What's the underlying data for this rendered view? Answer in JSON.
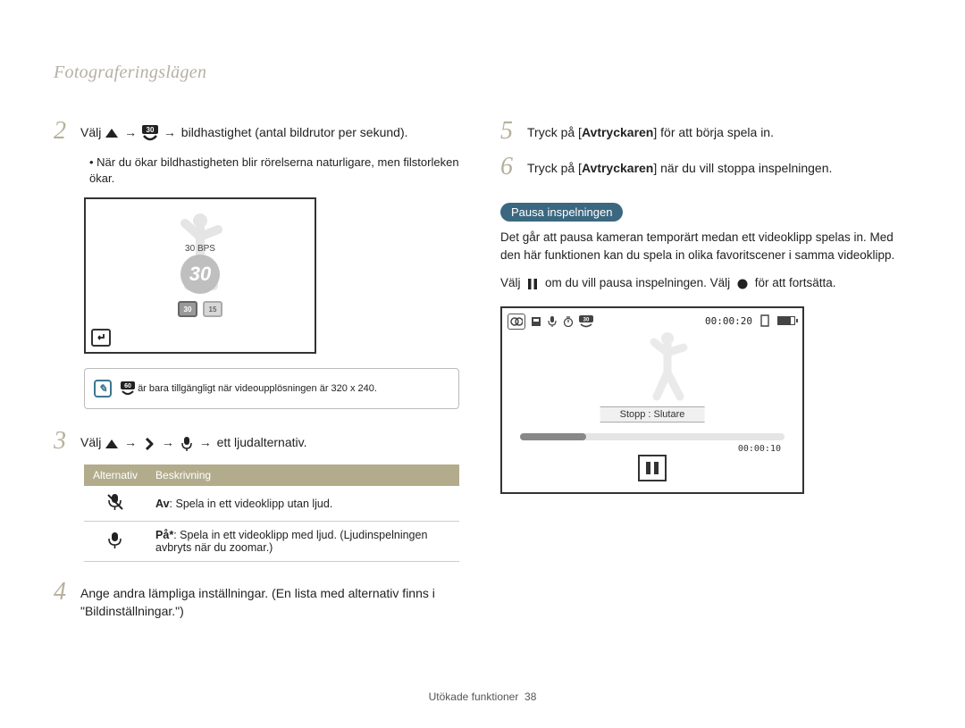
{
  "section_title": "Fotograferingslägen",
  "left": {
    "step2": {
      "num": "2",
      "prefix": "Välj ",
      "tail": " bildhastighet (antal bildrutor per sekund).",
      "bullet": "När du ökar bildhastigheten blir rörelserna naturligare, men filstorleken ökar."
    },
    "screenshot1": {
      "bps_label": "30 BPS",
      "bps_value": "30",
      "rate_a": "30",
      "rate_b": "15"
    },
    "note": {
      "icon_text": "60",
      "tail": "är bara tillgängligt när videoupplösningen är 320 x 240."
    },
    "step3": {
      "num": "3",
      "prefix": "Välj ",
      "tail": " ett ljudalternativ."
    },
    "table": {
      "h1": "Alternativ",
      "h2": "Beskrivning",
      "row1": {
        "bold": "Av",
        "rest": ": Spela in ett videoklipp utan ljud."
      },
      "row2": {
        "bold": "På*",
        "rest": ": Spela in ett videoklipp med ljud. (Ljudinspelningen avbryts när du zoomar.)"
      }
    },
    "step4": {
      "num": "4",
      "text": "Ange andra lämpliga inställningar. (En lista med alternativ finns i \"Bildinställningar.\")"
    }
  },
  "right": {
    "step5": {
      "num": "5",
      "prefix": "Tryck på [",
      "key": "Avtryckaren",
      "suffix": "] för att börja spela in."
    },
    "step6": {
      "num": "6",
      "prefix": "Tryck på [",
      "key": "Avtryckaren",
      "suffix": "] när du vill stoppa inspelningen."
    },
    "pill": "Pausa inspelningen",
    "para1": "Det går att pausa kameran temporärt medan ett videoklipp spelas in. Med den här funktionen kan du spela in olika favoritscener i samma videoklipp.",
    "para2_a": "Välj ",
    "para2_b": " om du vill pausa inspelningen. Välj ",
    "para2_c": " för att fortsätta.",
    "screenshot2": {
      "timer": "00:00:20",
      "label": "Stopp : Slutare",
      "elapsed": "00:00:10"
    }
  },
  "arrow": "→",
  "footer": {
    "label": "Utökade funktioner",
    "page": "38"
  }
}
